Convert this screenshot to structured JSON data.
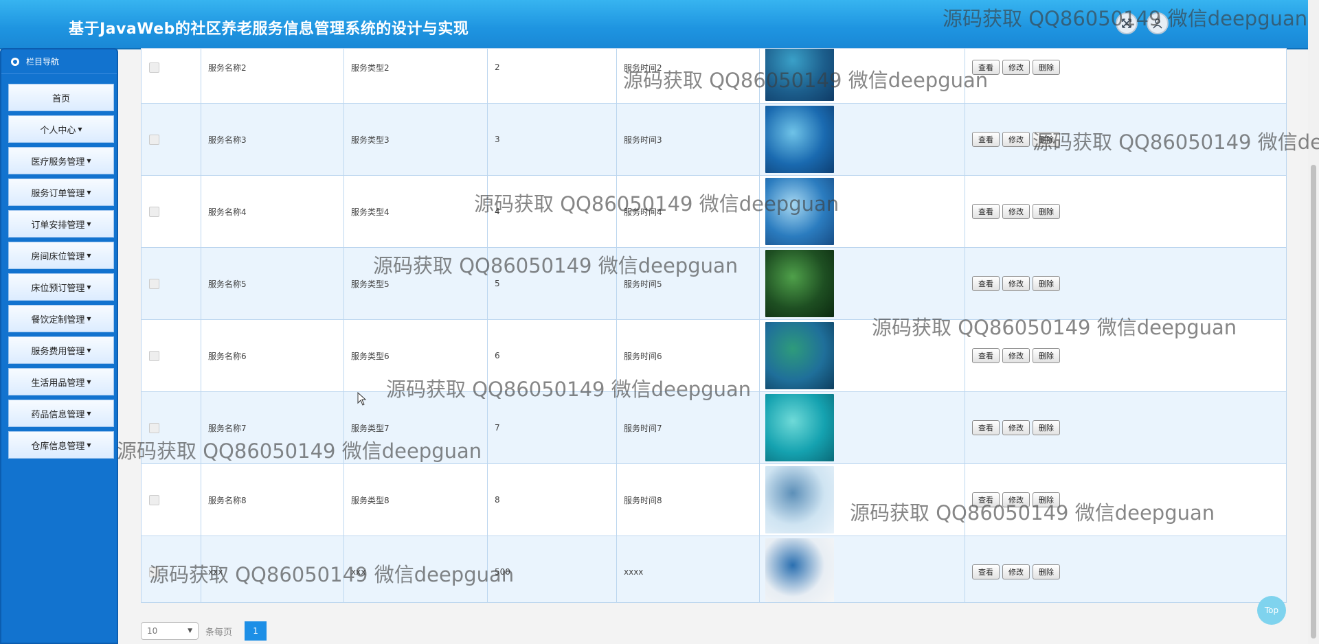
{
  "header": {
    "title": "基于JavaWeb的社区养老服务信息管理系统的设计与实现",
    "fullscreen_icon": "expand-icon",
    "user_icon": "user-icon"
  },
  "sidebar": {
    "title": "栏目导航",
    "items": [
      {
        "label": "首页",
        "dropdown": false
      },
      {
        "label": "个人中心",
        "dropdown": true
      },
      {
        "label": "医疗服务管理",
        "dropdown": true
      },
      {
        "label": "服务订单管理",
        "dropdown": true
      },
      {
        "label": "订单安排管理",
        "dropdown": true
      },
      {
        "label": "房间床位管理",
        "dropdown": true
      },
      {
        "label": "床位预订管理",
        "dropdown": true
      },
      {
        "label": "餐饮定制管理",
        "dropdown": true
      },
      {
        "label": "服务费用管理",
        "dropdown": true
      },
      {
        "label": "生活用品管理",
        "dropdown": true
      },
      {
        "label": "药品信息管理",
        "dropdown": true
      },
      {
        "label": "仓库信息管理",
        "dropdown": true
      }
    ]
  },
  "table": {
    "actions": {
      "view": "查看",
      "edit": "修改",
      "delete": "删除"
    },
    "rows": [
      {
        "name": "服务名称2",
        "type": "服务类型2",
        "num": "2",
        "time": "服务时间2",
        "img_colors": [
          "#1c5e8c",
          "#3aa0c8",
          "#0f3b66"
        ]
      },
      {
        "name": "服务名称3",
        "type": "服务类型3",
        "num": "3",
        "time": "服务时间3",
        "img_colors": [
          "#1a6ab0",
          "#6fc3e8",
          "#0d3f73"
        ]
      },
      {
        "name": "服务名称4",
        "type": "服务类型4",
        "num": "4",
        "time": "服务时间4",
        "img_colors": [
          "#2b7cbf",
          "#a6d8f2",
          "#174d86"
        ]
      },
      {
        "name": "服务名称5",
        "type": "服务类型5",
        "num": "5",
        "time": "服务时间5",
        "img_colors": [
          "#1e4f22",
          "#4fa04a",
          "#0c2a10"
        ]
      },
      {
        "name": "服务名称6",
        "type": "服务类型6",
        "num": "6",
        "time": "服务时间6",
        "img_colors": [
          "#1f6f9a",
          "#2e9b7b",
          "#0e3e5e"
        ]
      },
      {
        "name": "服务名称7",
        "type": "服务类型7",
        "num": "7",
        "time": "服务时间7",
        "img_colors": [
          "#15a2b0",
          "#6fdad8",
          "#0a6a78"
        ]
      },
      {
        "name": "服务名称8",
        "type": "服务类型8",
        "num": "8",
        "time": "服务时间8",
        "img_colors": [
          "#cfe4f2",
          "#5c8fb8",
          "#e8f2fa"
        ]
      },
      {
        "name": "xxx",
        "type": "xxx",
        "num": "500",
        "time": "xxxx",
        "img_colors": [
          "#e8eef4",
          "#2a6fb0",
          "#f7f7f7"
        ]
      }
    ]
  },
  "pagination": {
    "page_size": "10",
    "per_page_label": "条每页",
    "current_page": "1"
  },
  "top_button": "Top",
  "watermark": "源码获取 QQ86050149 微信deepguan"
}
